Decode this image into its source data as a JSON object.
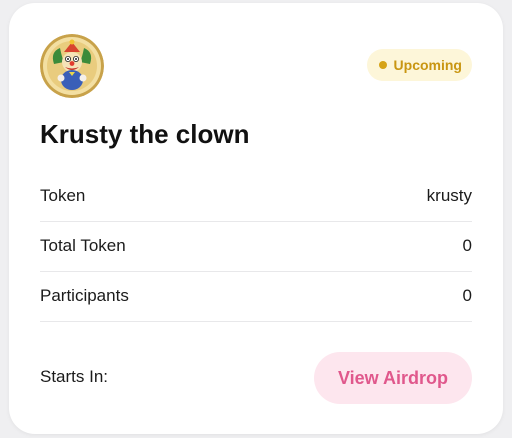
{
  "status": {
    "label": "Upcoming",
    "color": "#c99612"
  },
  "airdrop": {
    "title": "Krusty the clown",
    "avatar_icon": "krusty-clown-token-logo"
  },
  "details": [
    {
      "label": "Token",
      "value": "krusty"
    },
    {
      "label": "Total Token",
      "value": "0"
    },
    {
      "label": "Participants",
      "value": "0"
    }
  ],
  "footer": {
    "starts_label": "Starts In:",
    "button_label": "View Airdrop"
  },
  "colors": {
    "accent": "#e0588c",
    "accent_bg": "#fde6ee",
    "badge_bg": "#fdf6d9"
  }
}
